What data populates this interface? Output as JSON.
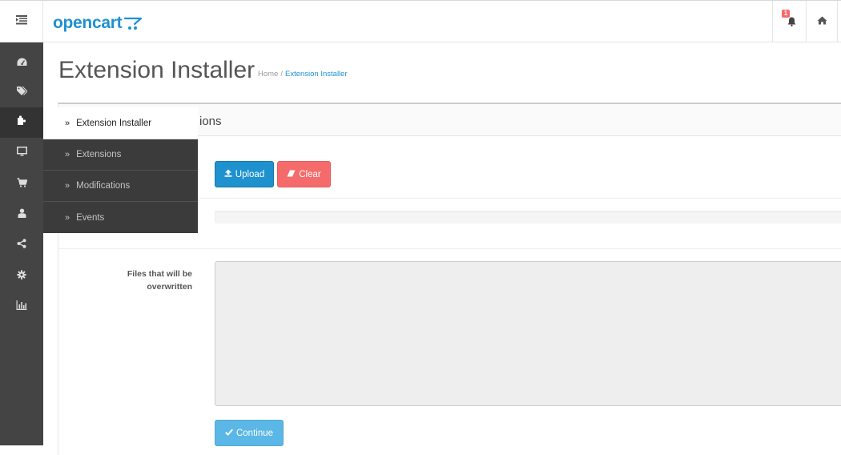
{
  "header": {
    "logo_text": "opencart",
    "notification_count": "1",
    "icons": [
      "menu-toggle-icon",
      "bell-icon",
      "home-icon"
    ],
    "accent_color": "#1e91cf"
  },
  "sidebar": {
    "icons": [
      "dashboard-icon",
      "tag-icon",
      "puzzle-icon",
      "monitor-icon",
      "cart-icon",
      "user-icon",
      "share-icon",
      "cog-icon",
      "chart-icon"
    ],
    "flyout": [
      {
        "label": "Extension Installer",
        "active": true
      },
      {
        "label": "Extensions",
        "active": false
      },
      {
        "label": "Modifications",
        "active": false
      },
      {
        "label": "Events",
        "active": false
      }
    ]
  },
  "page": {
    "title": "Extension Installer",
    "breadcrumb": [
      "Home",
      "Extension Installer"
    ],
    "breadcrumb_sep": "/"
  },
  "panel": {
    "heading_visible": "ions",
    "upload_label": "Upload",
    "clear_label": "Clear",
    "files_label_line1": "Files that will be",
    "files_label_line2": "overwritten",
    "continue_label": "Continue"
  }
}
